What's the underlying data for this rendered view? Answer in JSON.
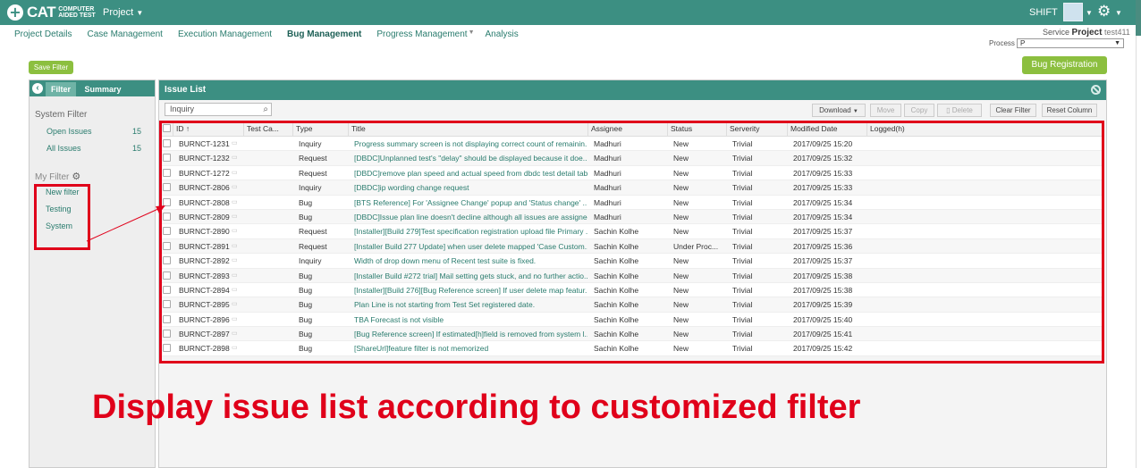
{
  "topbar": {
    "logo_text": "CAT",
    "logo_subtitle": "COMPUTER AIDED TEST",
    "project_menu": "Project",
    "user": "SHIFT"
  },
  "nav": {
    "tabs": [
      "Project Details",
      "Case Management",
      "Execution Management",
      "Bug Management",
      "Progress Management",
      "Analysis"
    ]
  },
  "service": {
    "label": "Service",
    "project_label": "Project",
    "project_name": "test411",
    "process_label": "Process",
    "process_value": "P"
  },
  "buttons": {
    "save_filter": "Save Filter",
    "bug_registration": "Bug Registration"
  },
  "left_panel": {
    "tab_filter": "Filter",
    "tab_summary": "Summary",
    "system_filter_title": "System Filter",
    "system_filters": [
      {
        "label": "Open Issues",
        "count": "15"
      },
      {
        "label": "All Issues",
        "count": "15"
      }
    ],
    "my_filter_title": "My Filter",
    "my_filters": [
      "New filter",
      "Testing",
      "System"
    ]
  },
  "issue_list": {
    "title": "Issue List",
    "search_placeholder": "Inquiry",
    "toolbar": {
      "download": "Download",
      "move": "Move",
      "copy": "Copy",
      "delete": "Delete",
      "clear_filter": "Clear Filter",
      "reset_column": "Reset Column"
    },
    "columns": [
      "ID",
      "Test Ca...",
      "Type",
      "Title",
      "Assignee",
      "Status",
      "Serverity",
      "Modified Date",
      "Logged(h)"
    ],
    "rows": [
      {
        "id": "BURNCT-1231",
        "type": "Inquiry",
        "title": "Progress summary screen is not displaying correct count of remainin...",
        "assignee": "Madhuri",
        "status": "New",
        "severity": "Trivial",
        "modified": "2017/09/25 15:20"
      },
      {
        "id": "BURNCT-1232",
        "type": "Request",
        "title": "[DBDC]Unplanned test's \"delay\" should be displayed because it doe...",
        "assignee": "Madhuri",
        "status": "New",
        "severity": "Trivial",
        "modified": "2017/09/25 15:32"
      },
      {
        "id": "BURNCT-1272",
        "type": "Request",
        "title": "[DBDC]remove plan speed and actual speed from dbdc test detail table",
        "assignee": "Madhuri",
        "status": "New",
        "severity": "Trivial",
        "modified": "2017/09/25 15:33"
      },
      {
        "id": "BURNCT-2806",
        "type": "Inquiry",
        "title": "[DBDC]ip wording change request",
        "assignee": "Madhuri",
        "status": "New",
        "severity": "Trivial",
        "modified": "2017/09/25 15:33"
      },
      {
        "id": "BURNCT-2808",
        "type": "Bug",
        "title": "[BTS Reference] For 'Assignee Change' popup and 'Status change' ...",
        "assignee": "Madhuri",
        "status": "New",
        "severity": "Trivial",
        "modified": "2017/09/25 15:34"
      },
      {
        "id": "BURNCT-2809",
        "type": "Bug",
        "title": "[DBDC]Issue plan line doesn't decline although all issues are assigned",
        "assignee": "Madhuri",
        "status": "New",
        "severity": "Trivial",
        "modified": "2017/09/25 15:34"
      },
      {
        "id": "BURNCT-2890",
        "type": "Request",
        "title": "[Installer][Build 279]Test specification registration upload file Primary ...",
        "assignee": "Sachin Kolhe",
        "status": "New",
        "severity": "Trivial",
        "modified": "2017/09/25 15:37"
      },
      {
        "id": "BURNCT-2891",
        "type": "Request",
        "title": "[Installer Build 277 Update] when user delete mapped 'Case Custom...",
        "assignee": "Sachin Kolhe",
        "status": "Under Proc...",
        "severity": "Trivial",
        "modified": "2017/09/25 15:36"
      },
      {
        "id": "BURNCT-2892",
        "type": "Inquiry",
        "title": "Width of drop down menu of Recent test suite is fixed.",
        "assignee": "Sachin Kolhe",
        "status": "New",
        "severity": "Trivial",
        "modified": "2017/09/25 15:37"
      },
      {
        "id": "BURNCT-2893",
        "type": "Bug",
        "title": "[Installer Build #272 trial] Mail setting gets stuck, and no further actio...",
        "assignee": "Sachin Kolhe",
        "status": "New",
        "severity": "Trivial",
        "modified": "2017/09/25 15:38"
      },
      {
        "id": "BURNCT-2894",
        "type": "Bug",
        "title": "[Installer][Build 276][Bug Reference screen] If user delete map featur...",
        "assignee": "Sachin Kolhe",
        "status": "New",
        "severity": "Trivial",
        "modified": "2017/09/25 15:38"
      },
      {
        "id": "BURNCT-2895",
        "type": "Bug",
        "title": "Plan Line is not starting from Test Set registered date.",
        "assignee": "Sachin Kolhe",
        "status": "New",
        "severity": "Trivial",
        "modified": "2017/09/25 15:39"
      },
      {
        "id": "BURNCT-2896",
        "type": "Bug",
        "title": "TBA Forecast is not visible",
        "assignee": "Sachin Kolhe",
        "status": "New",
        "severity": "Trivial",
        "modified": "2017/09/25 15:40"
      },
      {
        "id": "BURNCT-2897",
        "type": "Bug",
        "title": "[Bug Reference screen] If estimated[h]field is removed from system l...",
        "assignee": "Sachin Kolhe",
        "status": "New",
        "severity": "Trivial",
        "modified": "2017/09/25 15:41"
      },
      {
        "id": "BURNCT-2898",
        "type": "Bug",
        "title": "[ShareUrl]feature filter is not memorized",
        "assignee": "Sachin Kolhe",
        "status": "New",
        "severity": "Trivial",
        "modified": "2017/09/25 15:42"
      }
    ]
  },
  "caption": "Display issue list according to customized filter",
  "colors": {
    "header": "#3c8f82",
    "accent_green": "#8cbf3f",
    "annotation_red": "#e0001a"
  }
}
